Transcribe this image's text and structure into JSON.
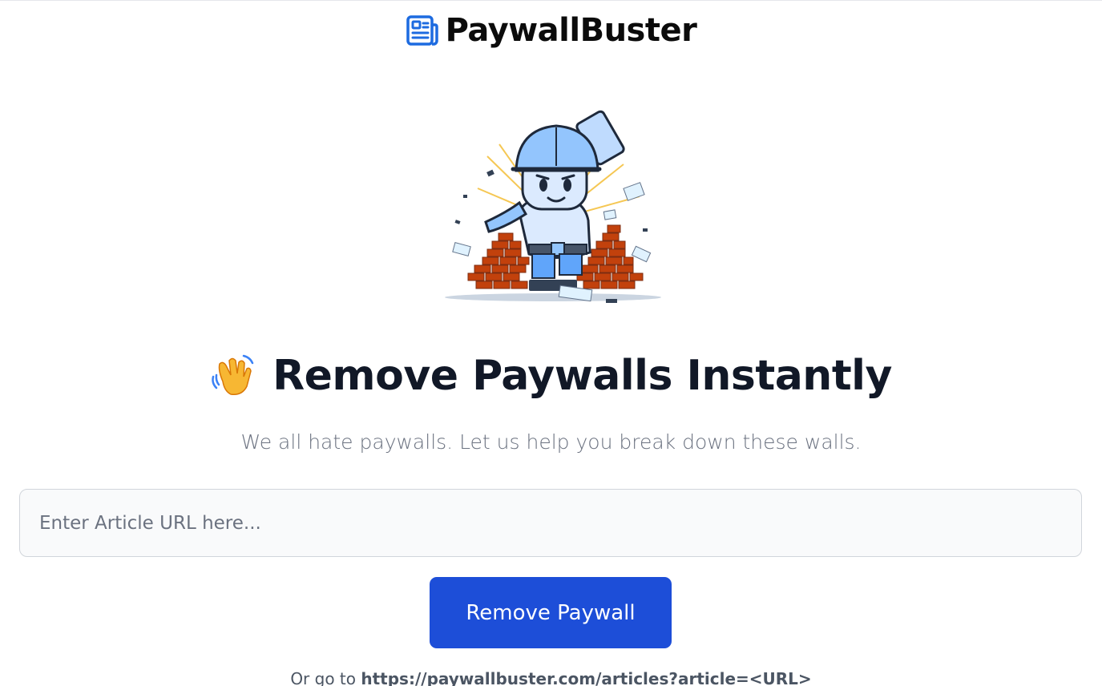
{
  "brand": {
    "name": "PaywallBuster",
    "icon": "newspaper-icon",
    "accent_color": "#1d6be0"
  },
  "hero": {
    "illustration": "worker-breaking-brick-wall-illustration"
  },
  "headline": {
    "emoji": "waving-hand-icon",
    "text": "Remove Paywalls Instantly"
  },
  "subtitle": "We all hate paywalls. Let us help you break down these walls.",
  "form": {
    "url_placeholder": "Enter Article URL here...",
    "url_value": "",
    "submit_label": "Remove Paywall",
    "button_color": "#1d4ed8"
  },
  "alt": {
    "prefix": "Or go to",
    "url": "https://paywallbuster.com/articles?article=<URL>"
  }
}
